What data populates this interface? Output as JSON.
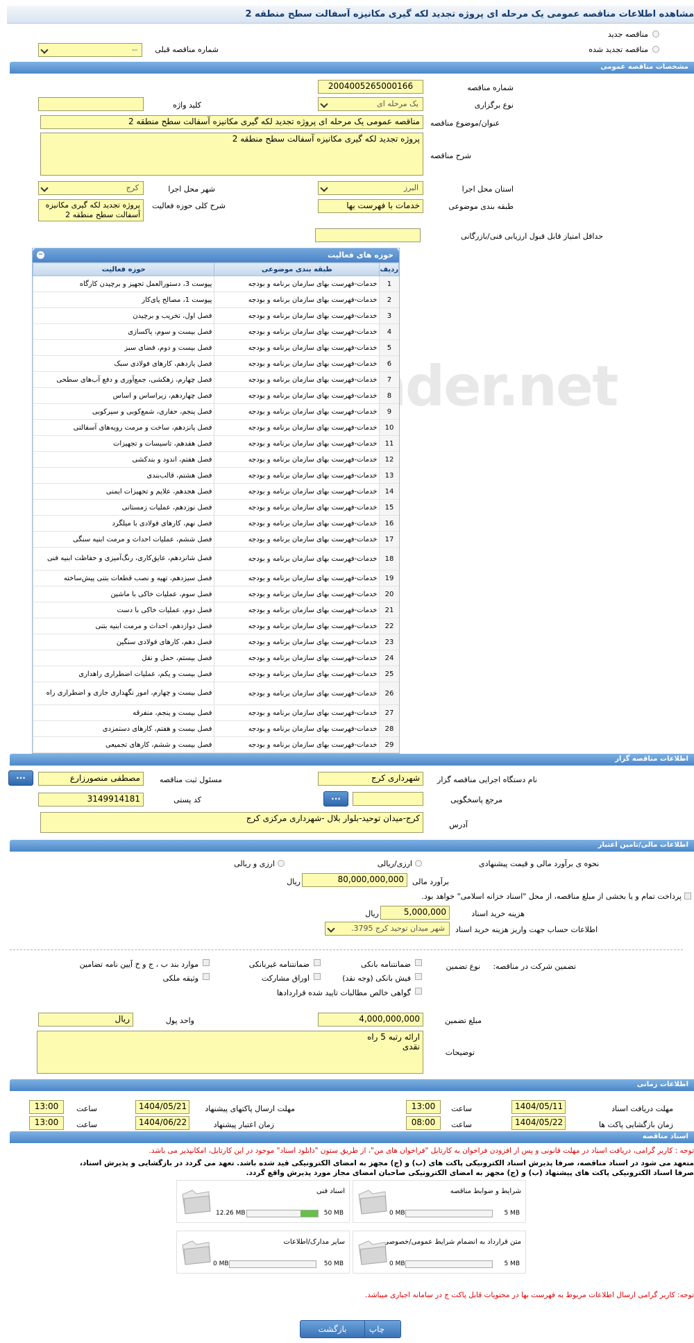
{
  "title": "مشاهده اطلاعات مناقصه عمومی یک مرحله ای پروژه تجدید لکه گیری مکانیزه آسفالت سطح منطقه 2",
  "top": {
    "radio_new": "مناقصه جدید",
    "radio_renew": "مناقصه تجدید شده",
    "prev_label": "شماره مناقصه قبلی",
    "prev_value": "--"
  },
  "general": {
    "header": "مشخصات مناقصه عمومی",
    "number_label": "شماره مناقصه",
    "number": "2004005265000166",
    "type_label": "نوع برگزاری",
    "type": "یک مرحله ای",
    "keyword_label": "کلید واژه",
    "keyword": "",
    "subject_label": "عنوان/موضوع مناقصه",
    "subject": "مناقصه عمومی یک مرحله ای پروژه تجدید لکه گیری مکانیزه آسفالت سطح منطقه 2",
    "desc_label": "شرح مناقصه",
    "desc": "پروژه تجدید لکه گیری مکانیزه آسفالت سطح منطقه 2",
    "province_label": "استان محل اجرا",
    "province": "البرز",
    "city_label": "شهر محل اجرا",
    "city": "کرج",
    "category_label": "طبقه بندی موضوعی",
    "category": "خدمات با فهرست بها",
    "scope_label": "شرح کلی حوزه فعالیت",
    "scope": "پروژه تجدید لکه گیری مکانیزه آسفالت سطح منطقه 2",
    "min_score_label": "حداقل امتیاز قابل قبول ارزیابی فنی/بازرگانی",
    "min_score": ""
  },
  "activities": {
    "header": "حوزه های فعالیت",
    "col_row": "ردیف",
    "col_cat": "طبقه بندی موضوعی",
    "col_area": "حوزه فعالیت",
    "rows": [
      {
        "n": "1",
        "c": "خدمات-فهرست بهای سازمان برنامه و بودجه",
        "a": "پیوست 3، دستورالعمل تجهیز و برچیدن کارگاه"
      },
      {
        "n": "2",
        "c": "خدمات-فهرست بهای سازمان برنامه و بودجه",
        "a": "پیوست 1، مصالح پای‌کار"
      },
      {
        "n": "3",
        "c": "خدمات-فهرست بهای سازمان برنامه و بودجه",
        "a": "فصل اول، تخریب و برچیدن"
      },
      {
        "n": "4",
        "c": "خدمات-فهرست بهای سازمان برنامه و بودجه",
        "a": "فصل بیست و سوم، پاکسازی"
      },
      {
        "n": "5",
        "c": "خدمات-فهرست بهای سازمان برنامه و بودجه",
        "a": "فصل بیست و دوم، فضای سبز"
      },
      {
        "n": "6",
        "c": "خدمات-فهرست بهای سازمان برنامه و بودجه",
        "a": "فصل یازدهم، کارهای فولادی سبک"
      },
      {
        "n": "7",
        "c": "خدمات-فهرست بهای سازمان برنامه و بودجه",
        "a": "فصل چهارم، زهکشی، جمع‌آوری و دفع آب‌های سطحی"
      },
      {
        "n": "8",
        "c": "خدمات-فهرست بهای سازمان برنامه و بودجه",
        "a": "فصل چهاردهم، زیراساس و اساس"
      },
      {
        "n": "9",
        "c": "خدمات-فهرست بهای سازمان برنامه و بودجه",
        "a": "فصل پنجم، حفاری، شمع‌کوبی و سپرکوبی"
      },
      {
        "n": "10",
        "c": "خدمات-فهرست بهای سازمان برنامه و بودجه",
        "a": "فصل پانزدهم، ساخت و مرمت رویه‌های آسفالتی"
      },
      {
        "n": "11",
        "c": "خدمات-فهرست بهای سازمان برنامه و بودجه",
        "a": "فصل هفدهم، تاسیسات و تجهیزات"
      },
      {
        "n": "12",
        "c": "خدمات-فهرست بهای سازمان برنامه و بودجه",
        "a": "فصل هفتم، اندود و بندکشی"
      },
      {
        "n": "13",
        "c": "خدمات-فهرست بهای سازمان برنامه و بودجه",
        "a": "فصل هشتم، قالب‌بندی"
      },
      {
        "n": "14",
        "c": "خدمات-فهرست بهای سازمان برنامه و بودجه",
        "a": "فصل هجدهم، علایم و تجهیزات ایمنی"
      },
      {
        "n": "15",
        "c": "خدمات-فهرست بهای سازمان برنامه و بودجه",
        "a": "فصل نوزدهم، عملیات زمستانی"
      },
      {
        "n": "16",
        "c": "خدمات-فهرست بهای سازمان برنامه و بودجه",
        "a": "فصل نهم، کارهای فولادی با میلگرد"
      },
      {
        "n": "17",
        "c": "خدمات-فهرست بهای سازمان برنامه و بودجه",
        "a": "فصل ششم،  عملیات احداث و مرمت ابنیه سنگی"
      },
      {
        "n": "18",
        "c": "خدمات-فهرست بهای سازمان برنامه و بودجه",
        "a": "فصل شانزدهم، عایق‌کاری، رنگ‌آمیزی و حفاظت ابنیه فنی",
        "tall": true
      },
      {
        "n": "19",
        "c": "خدمات-فهرست بهای سازمان برنامه و بودجه",
        "a": "فصل سیزدهم، تهیه و نصب قطعات بتنی پیش‌ساخته"
      },
      {
        "n": "20",
        "c": "خدمات-فهرست بهای سازمان برنامه و بودجه",
        "a": "فصل سوم، عملیات خاکی با ماشین"
      },
      {
        "n": "21",
        "c": "خدمات-فهرست بهای سازمان برنامه و بودجه",
        "a": "فصل دوم، عملیات خاکی با دست"
      },
      {
        "n": "22",
        "c": "خدمات-فهرست بهای سازمان برنامه و بودجه",
        "a": "فصل دوازدهم، احداث و مرمت ابنیه بتنی"
      },
      {
        "n": "23",
        "c": "خدمات-فهرست بهای سازمان برنامه و بودجه",
        "a": "فصل دهم، کارهای فولادی سنگین"
      },
      {
        "n": "24",
        "c": "خدمات-فهرست بهای سازمان برنامه و بودجه",
        "a": "فصل بیستم، حمل و نقل"
      },
      {
        "n": "25",
        "c": "خدمات-فهرست بهای سازمان برنامه و بودجه",
        "a": "فصل بیست و یکم، عملیات اضطراری راهداری"
      },
      {
        "n": "26",
        "c": "خدمات-فهرست بهای سازمان برنامه و بودجه",
        "a": "فصل بیست و چهارم، امور نگهداری جاری و اضطراری راه",
        "tall": true
      },
      {
        "n": "27",
        "c": "خدمات-فهرست بهای سازمان برنامه و بودجه",
        "a": "فصل بیست و پنجم، منفرقه"
      },
      {
        "n": "28",
        "c": "خدمات-فهرست بهای سازمان برنامه و بودجه",
        "a": "فصل بیست و هفتم، کارهای دستمزدی"
      },
      {
        "n": "29",
        "c": "خدمات-فهرست بهای سازمان برنامه و بودجه",
        "a": "فصل بیست و ششم، کارهای تجمیعی"
      }
    ]
  },
  "org": {
    "header": "اطلاعات مناقصه گزار",
    "exec_label": "نام دستگاه اجرایی مناقصه گزار",
    "exec": "شهرداری کرج",
    "resp_label": "مسئول ثبت مناقصه",
    "resp": "مصطفی منصورزارع",
    "ref_label": "مرجع پاسخگویی",
    "ref": "",
    "postal_label": "کد پستی",
    "postal": "3149914181",
    "addr_label": "آدرس",
    "addr": "کرج-میدان توحید-بلوار بلال -شهرداری مرکزی کرج",
    "dots": "..."
  },
  "finance": {
    "header": "اطلاعات مالی/تامین اعتبار",
    "method_label": "نحوه ی برآورد مالی و قیمت پیشنهادی",
    "opt_rial": "ارزی/ریالی",
    "opt_fx": "ارزی و ریالی",
    "estimate_label": "برآورد مالی",
    "estimate": "80,000,000,000",
    "rial": "ریال",
    "treasury": "پرداخت تمام و یا بخشی از مبلغ مناقصه، از محل \"اسناد خزانه اسلامی\" خواهد بود.",
    "doc_cost_label": "هزینه خرید اسناد",
    "doc_cost": "5,000,000",
    "account_label": "اطلاعات حساب جهت واریز هزینه خرید اسناد",
    "account": "شهر میدان توحید کرج 3795."
  },
  "guarantee": {
    "title": "تضمین شرکت در مناقصه:",
    "type_label": "نوع تضمین",
    "o1": "ضمانتنامه بانکی",
    "o2": "ضمانتنامه غیربانکی",
    "o3": "موارد بند ب ، ج و خ آیین نامه تضامین",
    "o4": "فیش بانکی (وجه نقد)",
    "o5": "اوراق مشارکت",
    "o6": "وثیقه ملکی",
    "o7": "گواهی خالص مطالبات تایید شده قراردادها",
    "amount_label": "مبلغ تضمین",
    "amount": "4,000,000,000",
    "unit_label": "واحد پول",
    "unit": "ریال",
    "notes_label": "توضیحات",
    "notes1": "ارائه رتبه 5 راه",
    "notes2": "نقدی"
  },
  "time": {
    "header": "اطلاعات زمانی",
    "recv_label": "مهلت دریافت اسناد",
    "recv_date": "1404/05/11",
    "recv_time": "13:00",
    "send_label": "مهلت ارسال پاکتهای پیشنهاد",
    "send_date": "1404/05/21",
    "send_time": "13:00",
    "open_label": "زمان بازگشایی پاکت ها",
    "open_date": "1404/05/22",
    "open_time": "08:00",
    "valid_label": "زمان اعتبار پیشنهاد",
    "valid_date": "1404/06/22",
    "valid_time": "13:00",
    "hour": "ساعت"
  },
  "docs": {
    "header": "اسناد مناقصه",
    "note1": "توجه : کاربر گرامی، دریافت اسناد در مهلت قانونی و پس از افزودن فراخوان به کارتابل \"فراخوان های من\"، از طریق ستون \"دانلود اسناد\" موجود در این کارتابل، امکانپذیر می باشد.",
    "note2": "متعهد می شود در اسناد مناقصه، صرفاً پذیرش اسناد الکترونیکی پاکت های (ب) و (ج) مجهز به امضای الکترونیکی قید شده باشد. تعهد می گردد در بازگشایی و پذیرش اسناد،",
    "note3": "صرفاً اسناد الکترونیکی پاکت های پیشنهاد (ب) و (ج) مجهز به امضای الکترونیکی صاحبان امضای مجاز مورد پذیرش واقع گردد.",
    "files": [
      {
        "name": "شرایط و ضوابط مناقصه",
        "used": "0 MB",
        "max": "5 MB",
        "pct": 0
      },
      {
        "name": "اسناد فنی",
        "used": "12.26 MB",
        "max": "50 MB",
        "pct": 0.245
      },
      {
        "name": "متن قرارداد به انضمام شرایط عمومی/خصوصی",
        "used": "0 MB",
        "max": "5 MB",
        "pct": 0
      },
      {
        "name": "سایر مدارک/اطلاعات",
        "used": "0 MB",
        "max": "50 MB",
        "pct": 0
      }
    ],
    "note4": "توجه: کاربر گرامی ارسال اطلاعات مربوط به فهرست بها در محتویات قابل پاکت ج در سامانه اجباری میباشد."
  },
  "buttons": {
    "print": "چاپ",
    "back": "بازگشت"
  },
  "watermark": "AriaTender.net"
}
